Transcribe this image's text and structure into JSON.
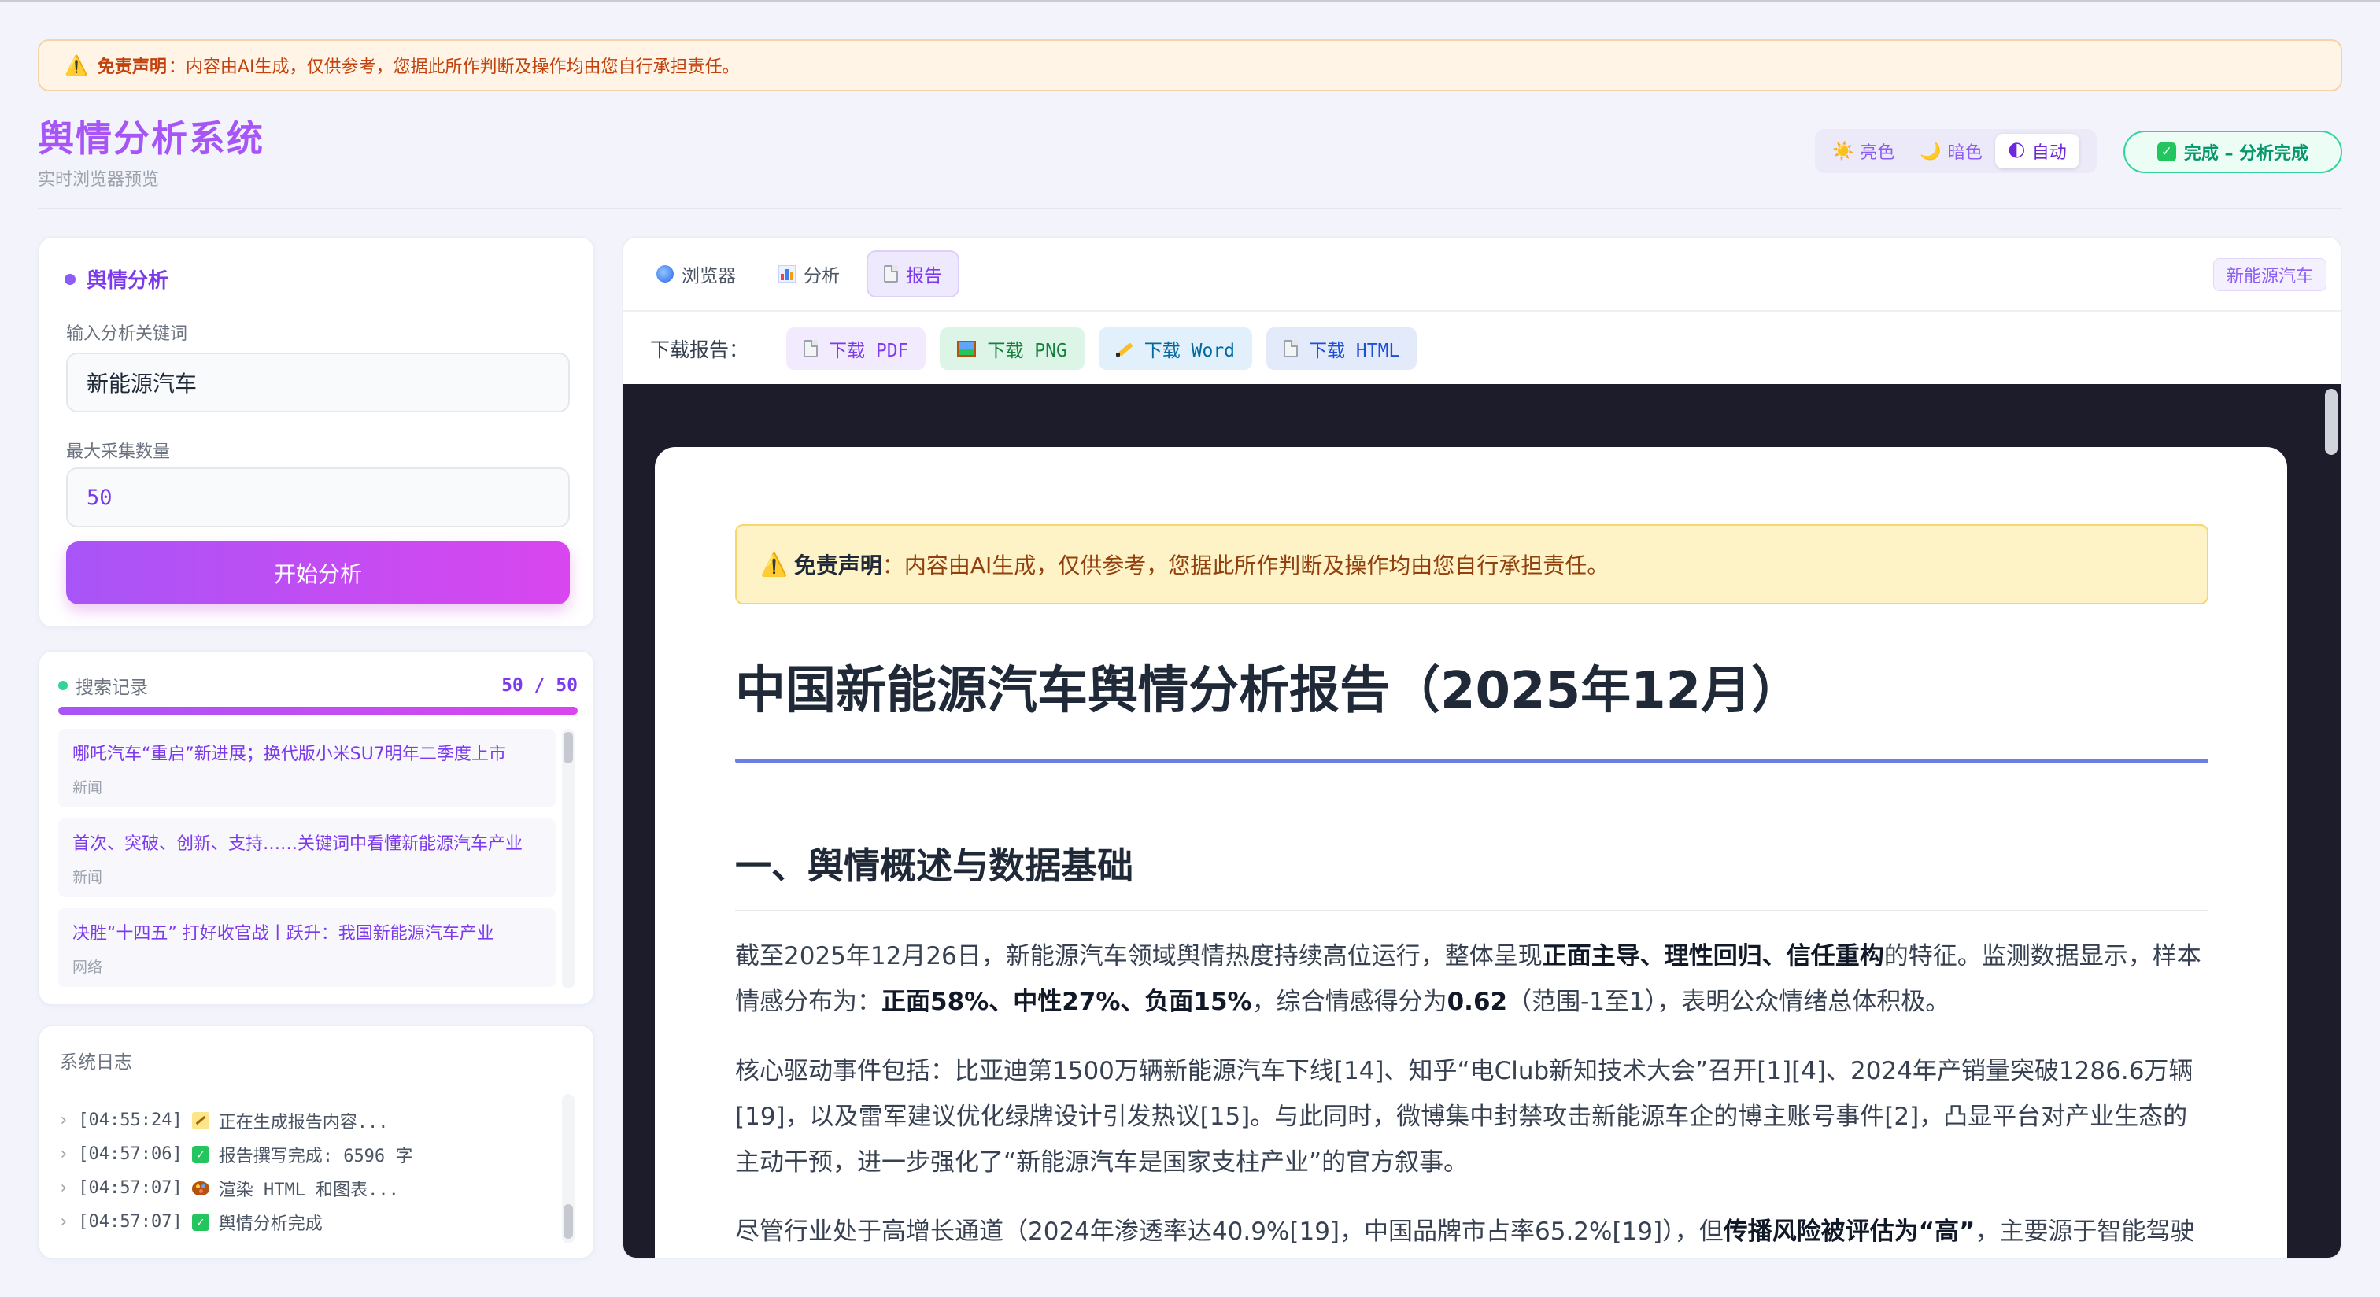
{
  "disclaimer": {
    "icon": "warning-icon",
    "label": "免责声明",
    "text": "：内容由AI生成，仅供参考，您据此所作判断及操作均由您自行承担责任。"
  },
  "header": {
    "title": "舆情分析系统",
    "subtitle": "实时浏览器预览"
  },
  "theme": {
    "options": [
      {
        "icon": "sun-icon",
        "label": "亮色"
      },
      {
        "icon": "moon-icon",
        "label": "暗色"
      },
      {
        "icon": "half-moon-icon",
        "label": "自动"
      }
    ],
    "selected": "自动"
  },
  "status": {
    "icon": "check-icon",
    "text": "完成 – 分析完成",
    "color": "#059669"
  },
  "analysis": {
    "heading": "舆情分析",
    "keyword_label": "输入分析关键词",
    "keyword_value": "新能源汽车",
    "max_label": "最大采集数量",
    "max_value": "50",
    "start_button": "开始分析"
  },
  "search": {
    "heading": "搜索记录",
    "count": "50 / 50",
    "progress": 1.0,
    "items": [
      {
        "title": "哪吒汽车“重启”新进展；换代版小米SU7明年二季度上市",
        "type": "新闻"
      },
      {
        "title": "首次、突破、创新、支持……关键词中看懂新能源汽车产业",
        "type": "新闻"
      },
      {
        "title": "决胜“十四五” 打好收官战丨跃升：我国新能源汽车产业",
        "type": "网络"
      }
    ]
  },
  "log": {
    "heading": "系统日志",
    "rows": [
      {
        "time": "[04:55:24]",
        "icon": "memo-icon",
        "text": "正在生成报告内容..."
      },
      {
        "time": "[04:57:06]",
        "icon": "check-icon",
        "text": "报告撰写完成: 6596 字"
      },
      {
        "time": "[04:57:07]",
        "icon": "palette-icon",
        "text": "渲染 HTML 和图表..."
      },
      {
        "time": "[04:57:07]",
        "icon": "check-icon",
        "text": "舆情分析完成"
      }
    ]
  },
  "tabs": [
    {
      "icon": "globe-icon",
      "label": "浏览器"
    },
    {
      "icon": "bar-chart-icon",
      "label": "分析"
    },
    {
      "icon": "document-icon",
      "label": "报告"
    }
  ],
  "active_tab": "报告",
  "topic_badge": "新能源汽车",
  "downloads": {
    "label": "下载报告：",
    "buttons": [
      {
        "icon": "document-icon",
        "label": "下载 PDF"
      },
      {
        "icon": "image-icon",
        "label": "下载 PNG"
      },
      {
        "icon": "pen-icon",
        "label": "下载 Word"
      },
      {
        "icon": "document-icon",
        "label": "下载 HTML"
      }
    ]
  },
  "report": {
    "disclaimer_label": "免责声明",
    "disclaimer_text": "：内容由AI生成，仅供参考，您据此所作判断及操作均由您自行承担责任。",
    "title": "中国新能源汽车舆情分析报告（2025年12月）",
    "section_title": "一、舆情概述与数据基础",
    "p1_a": "截至2025年12月26日，新能源汽车领域舆情热度持续高位运行，整体呈现",
    "p1_b": "正面主导、理性回归、信任重构",
    "p1_c": "的特征。监测数据显示，样本情感分布为：",
    "p1_d": "正面58%、中性27%、负面15%",
    "p1_e": "，综合情感得分为",
    "p1_f": "0.62",
    "p1_g": "（范围-1至1），表明公众情绪总体积极。",
    "p2": "核心驱动事件包括：比亚迪第1500万辆新能源汽车下线[14]、知乎“电Club新知技术大会”召开[1][4]、2024年产销量突破1286.6万辆[19]，以及雷军建议优化绿牌设计引发热议[15]。与此同时，微博集中封禁攻击新能源车企的博主账号事件[2]，凸显平台对产业生态的主动干预，进一步强化了“新能源汽车是国家支柱产业”的官方叙事。",
    "p3_a": "尽管行业处于高增长通道（2024年渗透率达40.9%[19]，中国品牌市占率65.2%[19]），但",
    "p3_b": "传播风险被评估为“高”",
    "p3_c": "，主要源于智能驾驶"
  }
}
